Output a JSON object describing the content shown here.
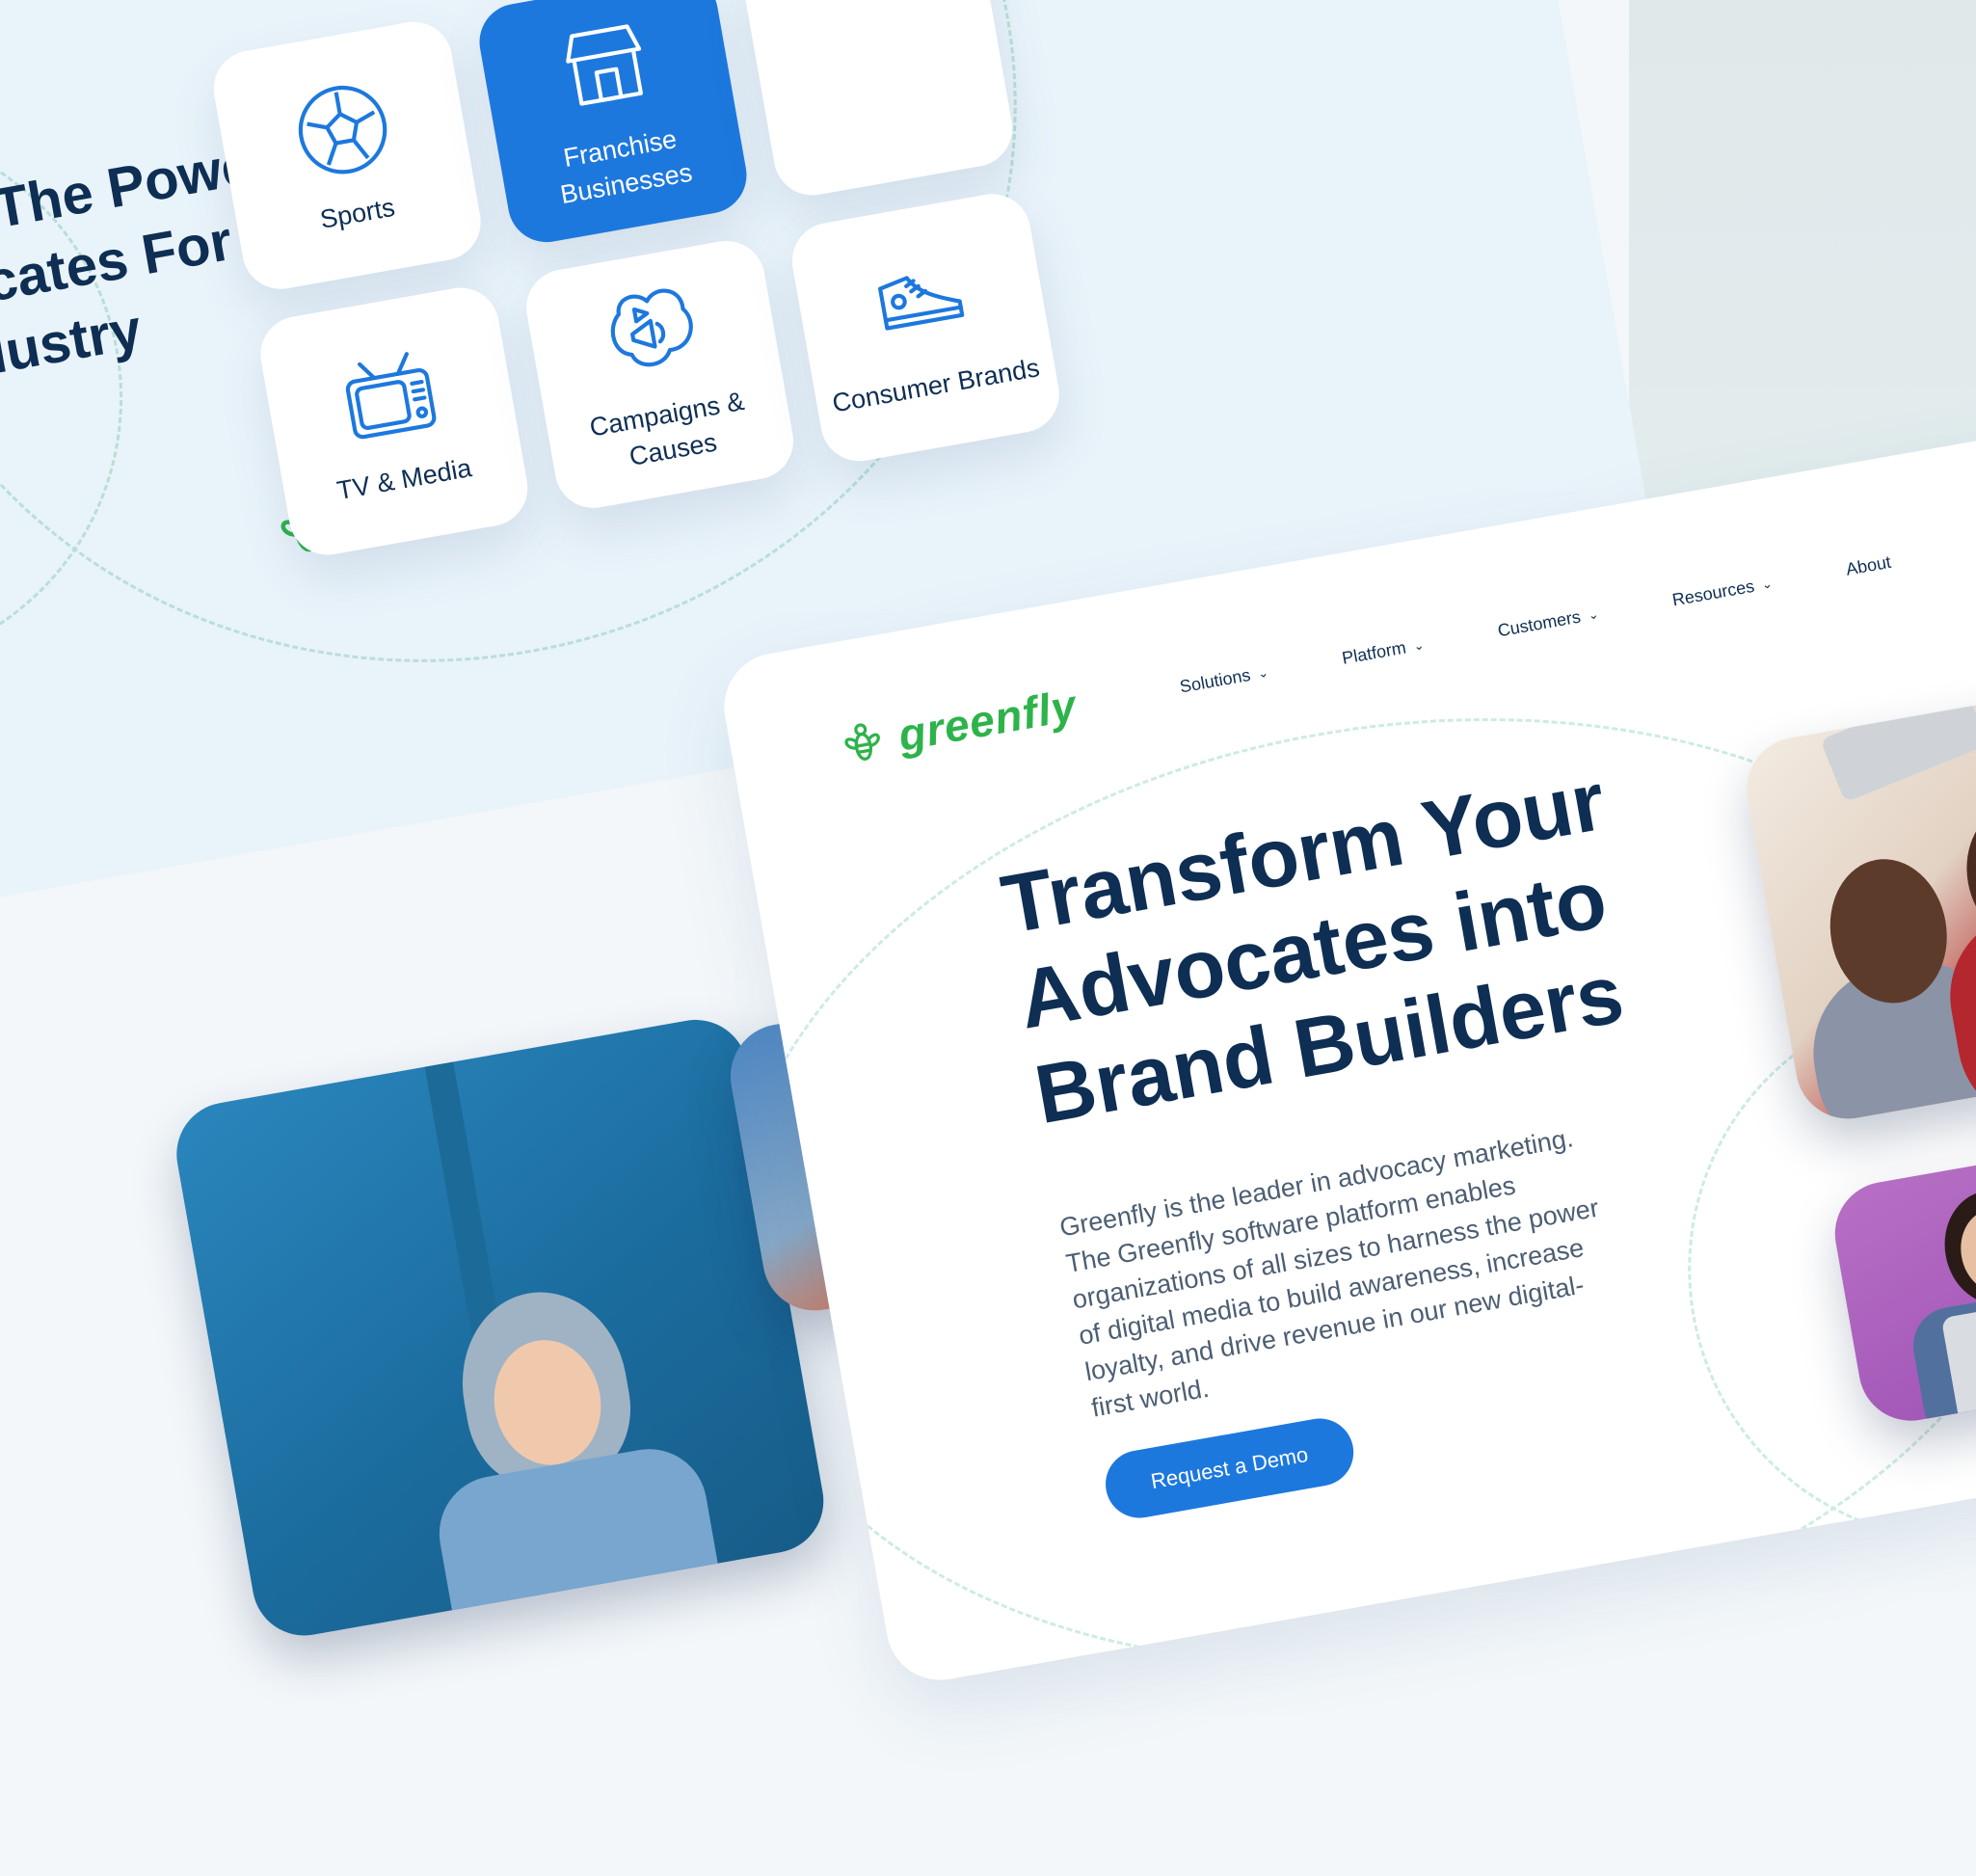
{
  "industries": {
    "title": "Harness The Power Of Advocates For Your Industry",
    "cards": [
      {
        "label": "Sports",
        "icon": "soccer-ball-icon",
        "active": false
      },
      {
        "label": "Franchise Businesses",
        "icon": "storefront-icon",
        "active": true
      },
      {
        "label": "",
        "icon": "",
        "active": false
      },
      {
        "label": "TV & Media",
        "icon": "tv-icon",
        "active": false
      },
      {
        "label": "Campaigns & Causes",
        "icon": "megaphone-icon",
        "active": false
      },
      {
        "label": "Consumer Brands",
        "icon": "sneaker-icon",
        "active": false
      }
    ]
  },
  "site": {
    "logo_text": "greenfly",
    "nav": [
      {
        "label": "Solutions",
        "has_dropdown": true
      },
      {
        "label": "Platform",
        "has_dropdown": true
      },
      {
        "label": "Customers",
        "has_dropdown": true
      },
      {
        "label": "Resources",
        "has_dropdown": true
      },
      {
        "label": "About",
        "has_dropdown": false
      }
    ],
    "hero": {
      "title": "Transform Your Advocates into Brand Builders",
      "description": "Greenfly is the leader in advocacy marketing. The Greenfly software platform enables organizations of all sizes to harness the power of digital media to build awareness, increase loyalty, and drive revenue in our new digital-first world.",
      "cta_label": "Request a Demo"
    }
  },
  "colors": {
    "primary_blue": "#1d78de",
    "navy_text": "#0e2e53",
    "brand_green": "#2db34a"
  }
}
